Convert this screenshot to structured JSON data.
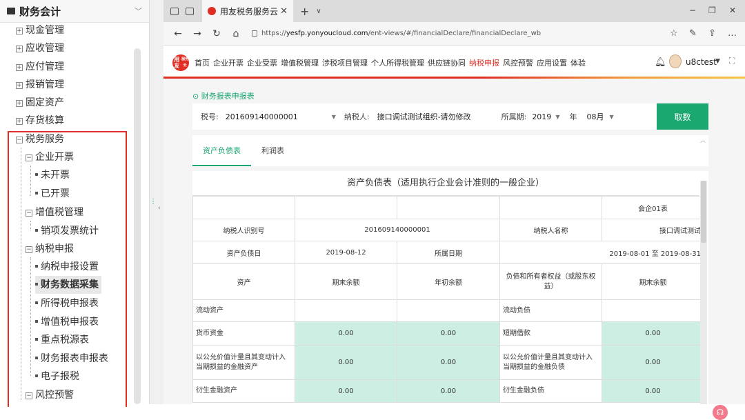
{
  "left_panel": {
    "title": "财务会计",
    "items": [
      {
        "label": "现金管理"
      },
      {
        "label": "应收管理"
      },
      {
        "label": "应付管理"
      },
      {
        "label": "报销管理"
      },
      {
        "label": "固定资产"
      },
      {
        "label": "存货核算"
      },
      {
        "label": "税务服务"
      },
      {
        "label": "企业开票"
      },
      {
        "label": "未开票"
      },
      {
        "label": "已开票"
      },
      {
        "label": "增值税管理"
      },
      {
        "label": "销项发票统计"
      },
      {
        "label": "纳税申报"
      },
      {
        "label": "纳税申报设置"
      },
      {
        "label": "财务数据采集"
      },
      {
        "label": "所得税申报表"
      },
      {
        "label": "增值税申报表"
      },
      {
        "label": "重点税源表"
      },
      {
        "label": "财务报表申报表"
      },
      {
        "label": "电子报税"
      },
      {
        "label": "风控预警"
      }
    ]
  },
  "browser": {
    "tab_title": "用友税务服务云",
    "url_prefix": "https://",
    "url_host": "yesfp.yonyoucloud.com",
    "url_path": "/ent-views/#/financialDeclare/financialDeclare_wb"
  },
  "app": {
    "logo_text": "用友",
    "logo_sub": "服务云",
    "nav": [
      "首页",
      "企业开票",
      "企业受票",
      "增值税管理",
      "涉税项目管理",
      "个人所得税管理",
      "供应链协同",
      "纳税申报",
      "风控预警",
      "应用设置",
      "体验"
    ],
    "active_nav": 7,
    "username": "u8ctest"
  },
  "breadcrumb": "财务报表申报表",
  "filter": {
    "tax_no_label": "税号:",
    "tax_no_value": "201609140000001",
    "taxpayer_label": "纳税人:",
    "taxpayer_value": "接口调试测试组织-请勿修改",
    "period_label": "所属期:",
    "year": "2019",
    "year_unit": "年",
    "month": "08月",
    "query_label": "取数"
  },
  "report_tabs": [
    "资产负债表",
    "利润表"
  ],
  "sheet": {
    "title": "资产负债表（适用执行企业会计准则的一般企业）",
    "form_code": "会企01表",
    "taxpayer_id_label": "纳税人识别号",
    "taxpayer_id_value": "201609140000001",
    "taxpayer_name_label": "纳税人名称",
    "taxpayer_name_value": "接口调试测试",
    "date_label": "资产负债日",
    "date_value": "2019-08-12",
    "period_label": "所属日期",
    "period_value": "2019-08-01 至 2019-08-31",
    "col_asset": "资产",
    "col_end": "期末余额",
    "col_begin": "年初余额",
    "col_liab": "负债和所有者权益（或股东权益）",
    "col_end2": "期末余额",
    "section_asset": "流动资产",
    "section_liab": "流动负债",
    "rows": [
      {
        "asset": "货币资金",
        "end": "0.00",
        "begin": "0.00",
        "liab": "短期借款",
        "end2": "0.00"
      },
      {
        "asset": "以公允价值计量且其变动计入当期损益的金融资产",
        "end": "0.00",
        "begin": "0.00",
        "liab": "以公允价值计量且其变动计入当期损益的金融负债",
        "end2": "0.00"
      },
      {
        "asset": "衍生金融资产",
        "end": "0.00",
        "begin": "0.00",
        "liab": "衍生金融负债",
        "end2": "0.00"
      }
    ]
  }
}
